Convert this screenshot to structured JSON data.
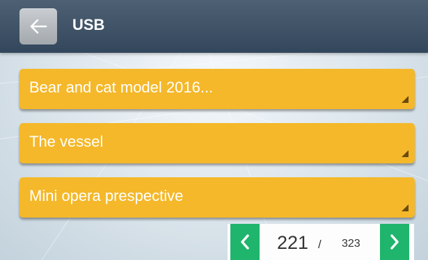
{
  "header": {
    "title": "USB",
    "back_icon": "arrow-left-icon"
  },
  "files": [
    {
      "label": "Bear and cat model 2016..."
    },
    {
      "label": "The vessel"
    },
    {
      "label": "Mini opera prespective"
    }
  ],
  "pagination": {
    "current": "221",
    "separator": "/",
    "total": "323",
    "prev_icon": "chevron-left-icon",
    "next_icon": "chevron-right-icon"
  },
  "colors": {
    "header": "#3d5166",
    "file_item": "#f4b82a",
    "nav_button": "#1fb56c"
  }
}
